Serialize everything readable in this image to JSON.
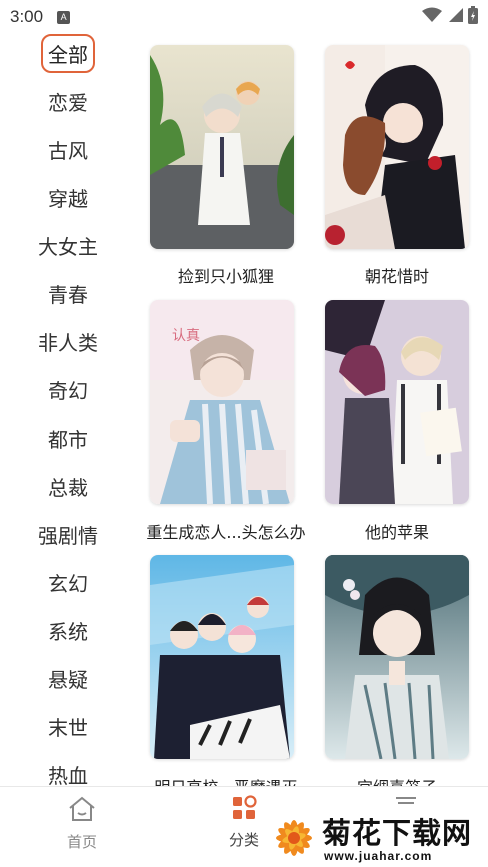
{
  "status_bar": {
    "time": "3:00",
    "notification_badge": "A"
  },
  "sidebar": {
    "items": [
      {
        "label": "全部",
        "active": true
      },
      {
        "label": "恋爱"
      },
      {
        "label": "古风"
      },
      {
        "label": "穿越"
      },
      {
        "label": "大女主"
      },
      {
        "label": "青春"
      },
      {
        "label": "非人类"
      },
      {
        "label": "奇幻"
      },
      {
        "label": "都市"
      },
      {
        "label": "总裁"
      },
      {
        "label": "强剧情"
      },
      {
        "label": "玄幻"
      },
      {
        "label": "系统"
      },
      {
        "label": "悬疑"
      },
      {
        "label": "末世"
      },
      {
        "label": "热血"
      }
    ]
  },
  "books": [
    {
      "title": "捡到只小狐狸"
    },
    {
      "title": "朝花惜时"
    },
    {
      "title": "重生成恋人...头怎么办"
    },
    {
      "title": "他的苹果"
    },
    {
      "title": "明日高校...恶魔遇灭"
    },
    {
      "title": "宫绸喜笼子"
    }
  ],
  "bottom_nav": {
    "home_label": "首页",
    "category_label": "分类",
    "active": "category"
  },
  "watermark": {
    "brand": "菊花下载网",
    "url": "www.juahar.com"
  },
  "colors": {
    "accent": "#e0643a",
    "inactive": "#888888"
  }
}
